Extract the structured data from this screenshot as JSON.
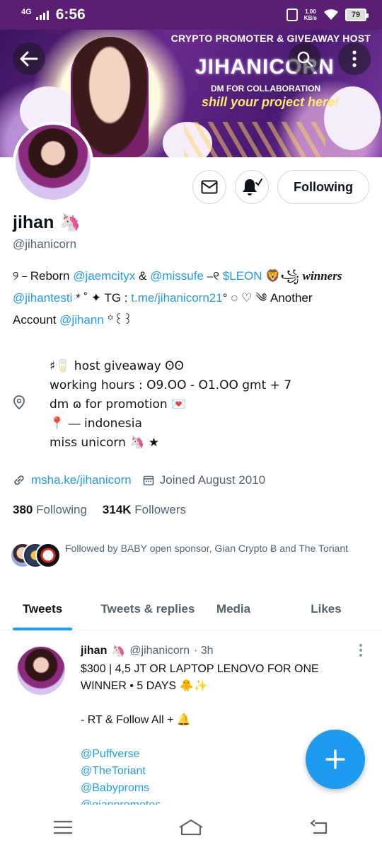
{
  "status_bar": {
    "network": "4G",
    "time": "6:56",
    "speed": "1.00",
    "speed_unit": "KB/s",
    "battery": "79"
  },
  "banner": {
    "top_title": "CRYPTO PROMOTER & GIVEAWAY HOST",
    "logo": "JIHANICORN",
    "sub": "DM FOR COLLABORATION",
    "tagline": "shill your project here!"
  },
  "profile": {
    "name": "jihan",
    "name_emoji": "🦄",
    "handle": "@jihanicorn",
    "following_label": "Following"
  },
  "bio": {
    "l1_a": "୨ ⎯ Reborn ",
    "m1": "@jaemcityx",
    "l1_b": " & ",
    "m2": "@missufe",
    "l1_c": " ⎯୧ ",
    "cashtag": "$LEON",
    "l1_d": " 🦁꧁ ",
    "winners": "winners",
    "m3": "@jihantesti",
    "l2_a": " * ˚ ✦ TG : ",
    "tg": "t.me/jihanicorn21",
    "l2_b": "° ◌ ♡ ༄ Another",
    "l3_a": "Account ",
    "m4": "@jihann",
    "l3_b": " ꙳꒰꒱"
  },
  "bio_lines": [
    "♯🥛  host  giveaway  ʘʘ",
    "working hours : O9.OO - O1.OO gmt + 7",
    "dm  ɷ  for  promotion  💌",
    "📍 ⎯⎯  indonesia",
    "miss  unicorn  🦄 ★"
  ],
  "meta": {
    "website": "msha.ke/jihanicorn",
    "joined": "Joined August 2010"
  },
  "counts": {
    "following_num": "380",
    "following_label": "Following",
    "followers_num": "314K",
    "followers_label": "Followers"
  },
  "followed_by": "Followed by BABY open sponsor, Gian Crypto Ƀ and The Toriant",
  "tabs": [
    "Tweets",
    "Tweets & replies",
    "Media",
    "Likes"
  ],
  "tweet": {
    "name": "jihan",
    "name_emoji": "🦄",
    "handle": "@jihanicorn",
    "time": "· 3h",
    "line1": "$300 | 4,5 JT OR LAPTOP LENOVO FOR ONE WINNER • 5 DAYS 🐥✨",
    "line2": "- RT & Follow All + 🔔",
    "mentions": [
      "@Puffverse",
      "@TheToriant",
      "@Babyproms",
      "@gianpromotes"
    ]
  },
  "colors": {
    "accent": "#1d9bf0",
    "status_bar": "#5a1f73",
    "text_secondary": "#536471"
  },
  "icons": [
    "back-arrow-icon",
    "search-icon",
    "more-vertical-icon",
    "mail-icon",
    "bell-check-icon",
    "location-pin-icon",
    "link-icon",
    "calendar-icon",
    "plus-icon",
    "menu-icon",
    "home-icon",
    "back-nav-icon"
  ]
}
